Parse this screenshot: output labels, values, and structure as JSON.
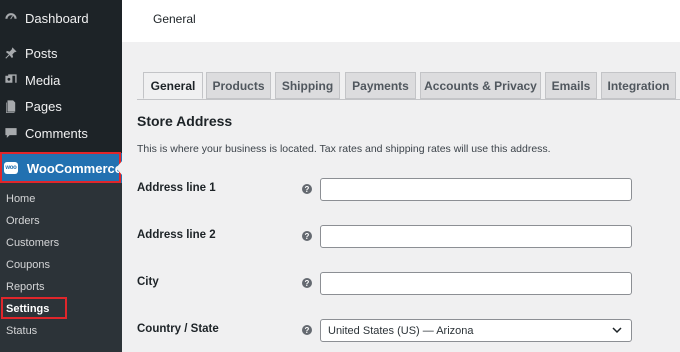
{
  "sidebar": {
    "items": [
      {
        "label": "Dashboard",
        "icon": "dashboard-icon"
      },
      {
        "label": "Posts",
        "icon": "pin-icon"
      },
      {
        "label": "Media",
        "icon": "media-icon"
      },
      {
        "label": "Pages",
        "icon": "pages-icon"
      },
      {
        "label": "Comments",
        "icon": "comment-icon"
      }
    ],
    "woocommerce": {
      "label": "WooCommerce",
      "logo_text": "woo"
    },
    "submenu": [
      "Home",
      "Orders",
      "Customers",
      "Coupons",
      "Reports",
      "Settings",
      "Status"
    ],
    "active_submenu": "Settings"
  },
  "header": {
    "title": "General"
  },
  "tabs": [
    "General",
    "Products",
    "Shipping",
    "Payments",
    "Accounts & Privacy",
    "Emails",
    "Integration"
  ],
  "active_tab": "General",
  "section": {
    "title": "Store Address",
    "description": "This is where your business is located. Tax rates and shipping rates will use this address."
  },
  "fields": {
    "address1": {
      "label": "Address line 1",
      "value": ""
    },
    "address2": {
      "label": "Address line 2",
      "value": ""
    },
    "city": {
      "label": "City",
      "value": ""
    },
    "country": {
      "label": "Country / State",
      "value": "United States (US) — Arizona"
    }
  },
  "colors": {
    "accent": "#2271b1",
    "sidebar": "#1d2327",
    "highlight": "#e0262b"
  }
}
